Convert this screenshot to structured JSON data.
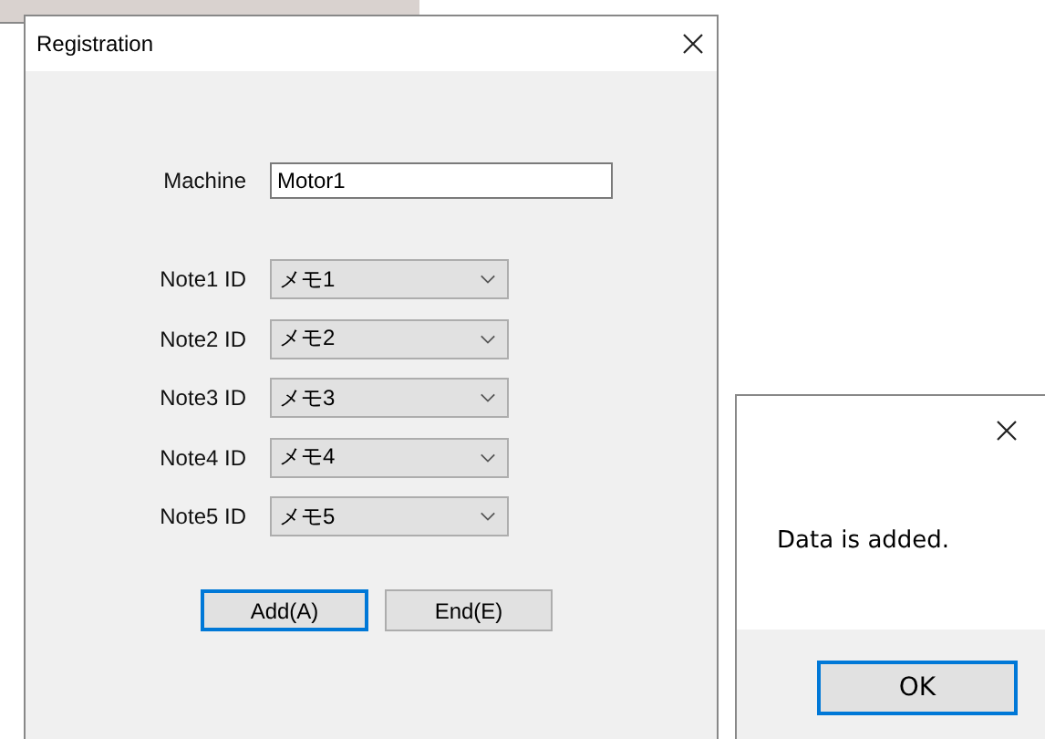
{
  "registration_dialog": {
    "title": "Registration",
    "machine": {
      "label": "Machine",
      "value": "Motor1"
    },
    "notes": [
      {
        "label": "Note1 ID",
        "value": "メモ1"
      },
      {
        "label": "Note2 ID",
        "value": "メモ2"
      },
      {
        "label": "Note3 ID",
        "value": "メモ3"
      },
      {
        "label": "Note4 ID",
        "value": "メモ4"
      },
      {
        "label": "Note5 ID",
        "value": "メモ5"
      }
    ],
    "buttons": [
      {
        "label": "Add(A)",
        "focused": true
      },
      {
        "label": "End(E)",
        "focused": false
      }
    ]
  },
  "message_box": {
    "message": "Data is added.",
    "buttons": [
      {
        "label": "OK",
        "focused": true
      }
    ]
  }
}
